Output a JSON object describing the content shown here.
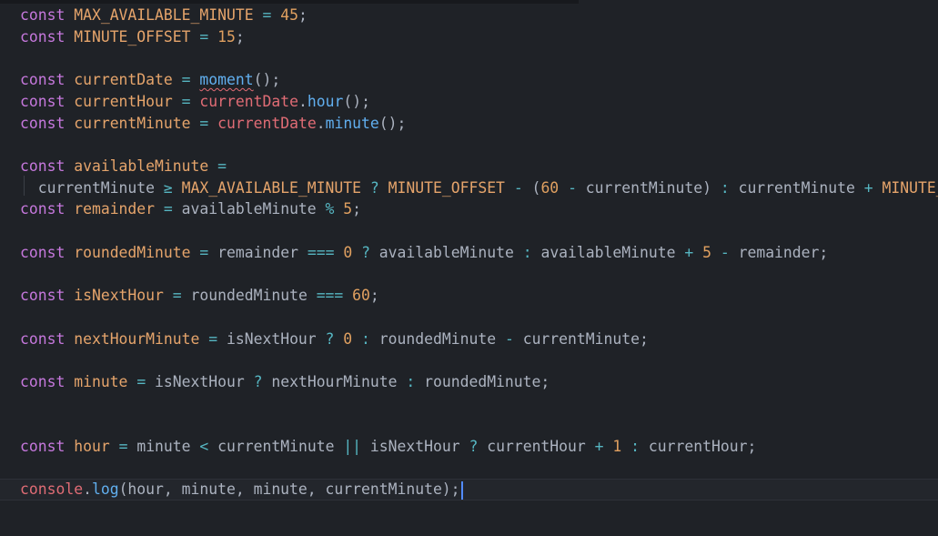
{
  "editor": {
    "lines": [
      [
        {
          "t": "const",
          "c": "kw"
        },
        {
          "t": " "
        },
        {
          "t": "MAX_AVAILABLE_MINUTE",
          "c": "const"
        },
        {
          "t": " "
        },
        {
          "t": "=",
          "c": "op"
        },
        {
          "t": " "
        },
        {
          "t": "45",
          "c": "num"
        },
        {
          "t": ";"
        }
      ],
      [
        {
          "t": "const",
          "c": "kw"
        },
        {
          "t": " "
        },
        {
          "t": "MINUTE_OFFSET",
          "c": "const"
        },
        {
          "t": " "
        },
        {
          "t": "=",
          "c": "op"
        },
        {
          "t": " "
        },
        {
          "t": "15",
          "c": "num"
        },
        {
          "t": ";"
        }
      ],
      [],
      [
        {
          "t": "const",
          "c": "kw"
        },
        {
          "t": " "
        },
        {
          "t": "currentDate",
          "c": "const"
        },
        {
          "t": " "
        },
        {
          "t": "=",
          "c": "op"
        },
        {
          "t": " "
        },
        {
          "t": "moment",
          "c": "fn squiggle"
        },
        {
          "t": "();"
        }
      ],
      [
        {
          "t": "const",
          "c": "kw"
        },
        {
          "t": " "
        },
        {
          "t": "currentHour",
          "c": "const"
        },
        {
          "t": " "
        },
        {
          "t": "=",
          "c": "op"
        },
        {
          "t": " "
        },
        {
          "t": "currentDate",
          "c": "var"
        },
        {
          "t": "."
        },
        {
          "t": "hour",
          "c": "fn"
        },
        {
          "t": "();"
        }
      ],
      [
        {
          "t": "const",
          "c": "kw"
        },
        {
          "t": " "
        },
        {
          "t": "currentMinute",
          "c": "const"
        },
        {
          "t": " "
        },
        {
          "t": "=",
          "c": "op"
        },
        {
          "t": " "
        },
        {
          "t": "currentDate",
          "c": "var"
        },
        {
          "t": "."
        },
        {
          "t": "minute",
          "c": "fn"
        },
        {
          "t": "();"
        }
      ],
      [],
      [
        {
          "t": "const",
          "c": "kw"
        },
        {
          "t": " "
        },
        {
          "t": "availableMinute",
          "c": "const"
        },
        {
          "t": " "
        },
        {
          "t": "=",
          "c": "op"
        }
      ],
      [
        {
          "t": "  currentMinute "
        },
        {
          "t": "≥",
          "c": "op"
        },
        {
          "t": " "
        },
        {
          "t": "MAX_AVAILABLE_MINUTE",
          "c": "const"
        },
        {
          "t": " "
        },
        {
          "t": "?",
          "c": "op"
        },
        {
          "t": " "
        },
        {
          "t": "MINUTE_OFFSET",
          "c": "const"
        },
        {
          "t": " "
        },
        {
          "t": "-",
          "c": "op"
        },
        {
          "t": " ("
        },
        {
          "t": "60",
          "c": "num"
        },
        {
          "t": " "
        },
        {
          "t": "-",
          "c": "op"
        },
        {
          "t": " currentMinute) "
        },
        {
          "t": ":",
          "c": "op"
        },
        {
          "t": " currentMinute "
        },
        {
          "t": "+",
          "c": "op"
        },
        {
          "t": " "
        },
        {
          "t": "MINUTE_OFFSET",
          "c": "const"
        },
        {
          "t": ";"
        }
      ],
      [
        {
          "t": "const",
          "c": "kw"
        },
        {
          "t": " "
        },
        {
          "t": "remainder",
          "c": "const"
        },
        {
          "t": " "
        },
        {
          "t": "=",
          "c": "op"
        },
        {
          "t": " availableMinute "
        },
        {
          "t": "%",
          "c": "op"
        },
        {
          "t": " "
        },
        {
          "t": "5",
          "c": "num"
        },
        {
          "t": ";"
        }
      ],
      [],
      [
        {
          "t": "const",
          "c": "kw"
        },
        {
          "t": " "
        },
        {
          "t": "roundedMinute",
          "c": "const"
        },
        {
          "t": " "
        },
        {
          "t": "=",
          "c": "op"
        },
        {
          "t": " remainder "
        },
        {
          "t": "===",
          "c": "op"
        },
        {
          "t": " "
        },
        {
          "t": "0",
          "c": "num"
        },
        {
          "t": " "
        },
        {
          "t": "?",
          "c": "op"
        },
        {
          "t": " availableMinute "
        },
        {
          "t": ":",
          "c": "op"
        },
        {
          "t": " availableMinute "
        },
        {
          "t": "+",
          "c": "op"
        },
        {
          "t": " "
        },
        {
          "t": "5",
          "c": "num"
        },
        {
          "t": " "
        },
        {
          "t": "-",
          "c": "op"
        },
        {
          "t": " remainder;"
        }
      ],
      [],
      [
        {
          "t": "const",
          "c": "kw"
        },
        {
          "t": " "
        },
        {
          "t": "isNextHour",
          "c": "const"
        },
        {
          "t": " "
        },
        {
          "t": "=",
          "c": "op"
        },
        {
          "t": " roundedMinute "
        },
        {
          "t": "===",
          "c": "op"
        },
        {
          "t": " "
        },
        {
          "t": "60",
          "c": "num"
        },
        {
          "t": ";"
        }
      ],
      [],
      [
        {
          "t": "const",
          "c": "kw"
        },
        {
          "t": " "
        },
        {
          "t": "nextHourMinute",
          "c": "const"
        },
        {
          "t": " "
        },
        {
          "t": "=",
          "c": "op"
        },
        {
          "t": " isNextHour "
        },
        {
          "t": "?",
          "c": "op"
        },
        {
          "t": " "
        },
        {
          "t": "0",
          "c": "num"
        },
        {
          "t": " "
        },
        {
          "t": ":",
          "c": "op"
        },
        {
          "t": " roundedMinute "
        },
        {
          "t": "-",
          "c": "op"
        },
        {
          "t": " currentMinute;"
        }
      ],
      [],
      [
        {
          "t": "const",
          "c": "kw"
        },
        {
          "t": " "
        },
        {
          "t": "minute",
          "c": "const"
        },
        {
          "t": " "
        },
        {
          "t": "=",
          "c": "op"
        },
        {
          "t": " isNextHour "
        },
        {
          "t": "?",
          "c": "op"
        },
        {
          "t": " nextHourMinute "
        },
        {
          "t": ":",
          "c": "op"
        },
        {
          "t": " roundedMinute;"
        }
      ],
      [],
      [],
      [
        {
          "t": "const",
          "c": "kw"
        },
        {
          "t": " "
        },
        {
          "t": "hour",
          "c": "const"
        },
        {
          "t": " "
        },
        {
          "t": "=",
          "c": "op"
        },
        {
          "t": " minute "
        },
        {
          "t": "<",
          "c": "op"
        },
        {
          "t": " currentMinute "
        },
        {
          "t": "||",
          "c": "op"
        },
        {
          "t": " isNextHour "
        },
        {
          "t": "?",
          "c": "op"
        },
        {
          "t": " currentHour "
        },
        {
          "t": "+",
          "c": "op"
        },
        {
          "t": " "
        },
        {
          "t": "1",
          "c": "num"
        },
        {
          "t": " "
        },
        {
          "t": ":",
          "c": "op"
        },
        {
          "t": " currentHour;"
        }
      ],
      [],
      [
        {
          "t": "console",
          "c": "var"
        },
        {
          "t": "."
        },
        {
          "t": "log",
          "c": "fn"
        },
        {
          "t": "(hour, minute, minute, currentMinute);"
        }
      ]
    ],
    "cursor_line": 22,
    "colors": {
      "background": "#1f2227",
      "keyword": "#c678dd",
      "constant": "#e5a46b",
      "number": "#e0a060",
      "variable": "#e06c75",
      "function": "#61afef",
      "operator": "#56b6c2",
      "plain": "#abb2bf",
      "cursor": "#528bff"
    }
  }
}
